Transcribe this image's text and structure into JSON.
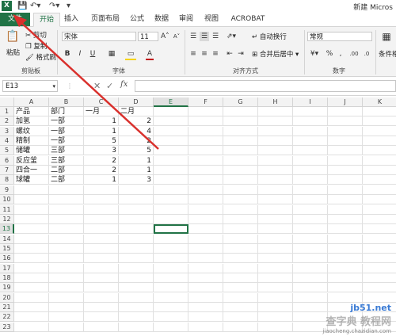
{
  "titlebar": {
    "app_icon": "X",
    "window_title": "新建 Micros"
  },
  "tabs": [
    "文件",
    "开始",
    "插入",
    "页面布局",
    "公式",
    "数据",
    "审阅",
    "视图",
    "ACROBAT"
  ],
  "ribbon": {
    "clipboard": {
      "paste": "粘贴",
      "cut": "剪切",
      "copy": "复制",
      "format_painter": "格式刷",
      "label": "剪贴板"
    },
    "font": {
      "name": "宋体",
      "size": "11",
      "grow": "A",
      "shrink": "A",
      "bold": "B",
      "italic": "I",
      "underline": "U",
      "font_color": "A",
      "label": "字体"
    },
    "alignment": {
      "wrap": "自动换行",
      "merge": "合并后居中",
      "label": "对齐方式"
    },
    "number": {
      "format": "常规",
      "label": "数字"
    },
    "styles": {
      "cond_format": "条件格"
    }
  },
  "formula_bar": {
    "name_box": "E13",
    "fx": "fx",
    "value": ""
  },
  "columns": [
    "A",
    "B",
    "C",
    "D",
    "E",
    "F",
    "G",
    "H",
    "I",
    "J",
    "K"
  ],
  "selected_column": "E",
  "selected_row": "13",
  "rows": [
    "1",
    "2",
    "3",
    "4",
    "5",
    "6",
    "7",
    "8",
    "9",
    "10",
    "11",
    "12",
    "13",
    "14",
    "15",
    "16",
    "17",
    "18",
    "19",
    "20",
    "21",
    "22",
    "23"
  ],
  "table": [
    [
      "产品",
      "部门",
      "一月",
      "二月"
    ],
    [
      "加氢",
      "一部",
      "1",
      "2"
    ],
    [
      "螺纹",
      "一部",
      "1",
      "4"
    ],
    [
      "精制",
      "一部",
      "5",
      "2"
    ],
    [
      "储罐",
      "三部",
      "3",
      "5"
    ],
    [
      "反应釜",
      "三部",
      "2",
      "1"
    ],
    [
      "四合一",
      "二部",
      "2",
      "1"
    ],
    [
      "球罐",
      "二部",
      "1",
      "3"
    ]
  ],
  "watermark": {
    "line1": "jb51.net",
    "line2": "查字典 教程网",
    "line3": "jiaocheng.chazidian.com"
  },
  "colors": {
    "accent": "#217346",
    "arrow": "#d9302c"
  }
}
